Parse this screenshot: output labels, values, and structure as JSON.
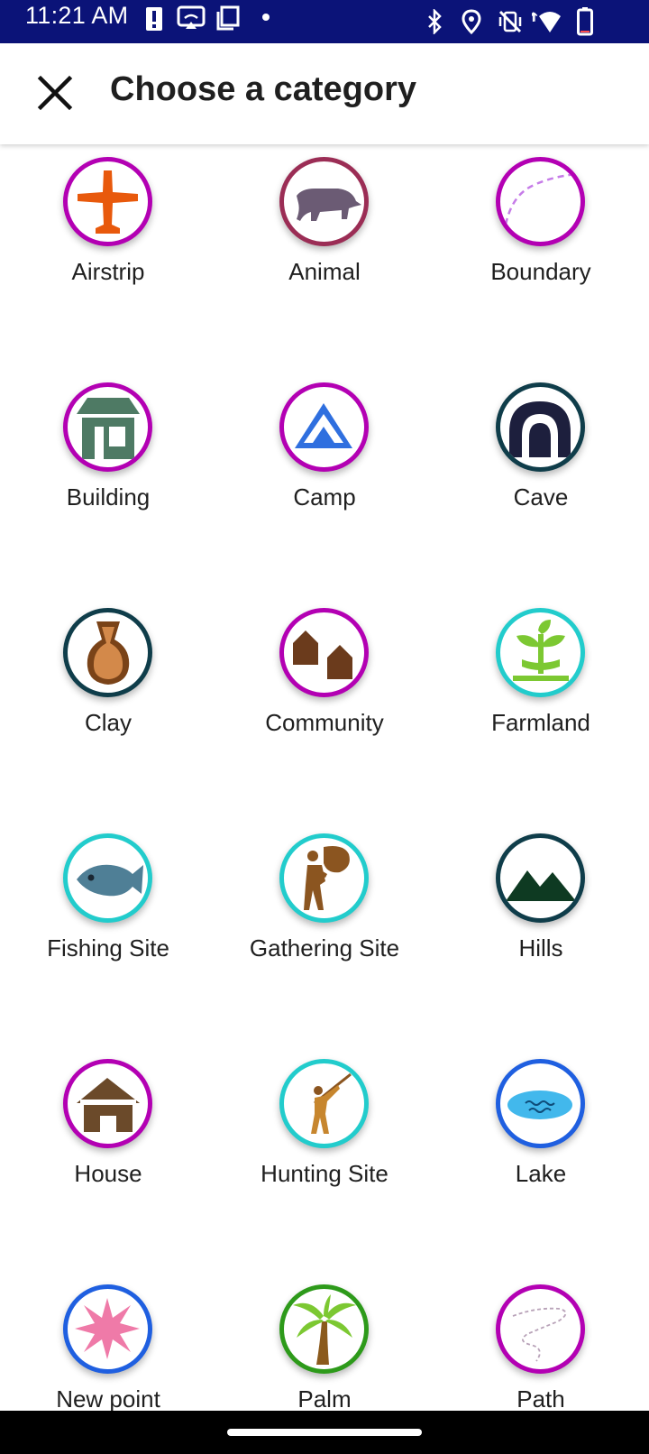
{
  "status_bar": {
    "time": "11:21 AM",
    "background": "#0b1378",
    "left_icons": [
      "alert-icon",
      "cast-icon",
      "screenshot-icon",
      "dot-icon"
    ],
    "right_icons": [
      "bluetooth-icon",
      "location-icon",
      "vibrate-off-icon",
      "wifi-icon",
      "battery-icon"
    ]
  },
  "header": {
    "title": "Choose a category",
    "close_icon": "close-icon"
  },
  "categories": [
    {
      "label": "Airstrip",
      "icon": "airplane-icon",
      "ring": "#b300b3"
    },
    {
      "label": "Animal",
      "icon": "animal-icon",
      "ring": "#9b2d55"
    },
    {
      "label": "Boundary",
      "icon": "boundary-icon",
      "ring": "#b300b3"
    },
    {
      "label": "Building",
      "icon": "building-icon",
      "ring": "#b300b3"
    },
    {
      "label": "Camp",
      "icon": "camp-icon",
      "ring": "#b300b3"
    },
    {
      "label": "Cave",
      "icon": "cave-icon",
      "ring": "#0f3d4a"
    },
    {
      "label": "Clay",
      "icon": "clay-pot-icon",
      "ring": "#0f3d4a"
    },
    {
      "label": "Community",
      "icon": "community-icon",
      "ring": "#b300b3"
    },
    {
      "label": "Farmland",
      "icon": "farmland-icon",
      "ring": "#22cccc"
    },
    {
      "label": "Fishing Site",
      "icon": "fish-icon",
      "ring": "#22cccc"
    },
    {
      "label": "Gathering Site",
      "icon": "gathering-icon",
      "ring": "#22cccc"
    },
    {
      "label": "Hills",
      "icon": "hills-icon",
      "ring": "#0f3d4a"
    },
    {
      "label": "House",
      "icon": "house-icon",
      "ring": "#b300b3"
    },
    {
      "label": "Hunting Site",
      "icon": "hunting-icon",
      "ring": "#22cccc"
    },
    {
      "label": "Lake",
      "icon": "lake-icon",
      "ring": "#1f5fe0"
    },
    {
      "label": "New point",
      "icon": "star-burst-icon",
      "ring": "#1f5fe0"
    },
    {
      "label": "Palm",
      "icon": "palm-tree-icon",
      "ring": "#2d9a1a"
    },
    {
      "label": "Path",
      "icon": "path-icon",
      "ring": "#b300b3"
    }
  ]
}
